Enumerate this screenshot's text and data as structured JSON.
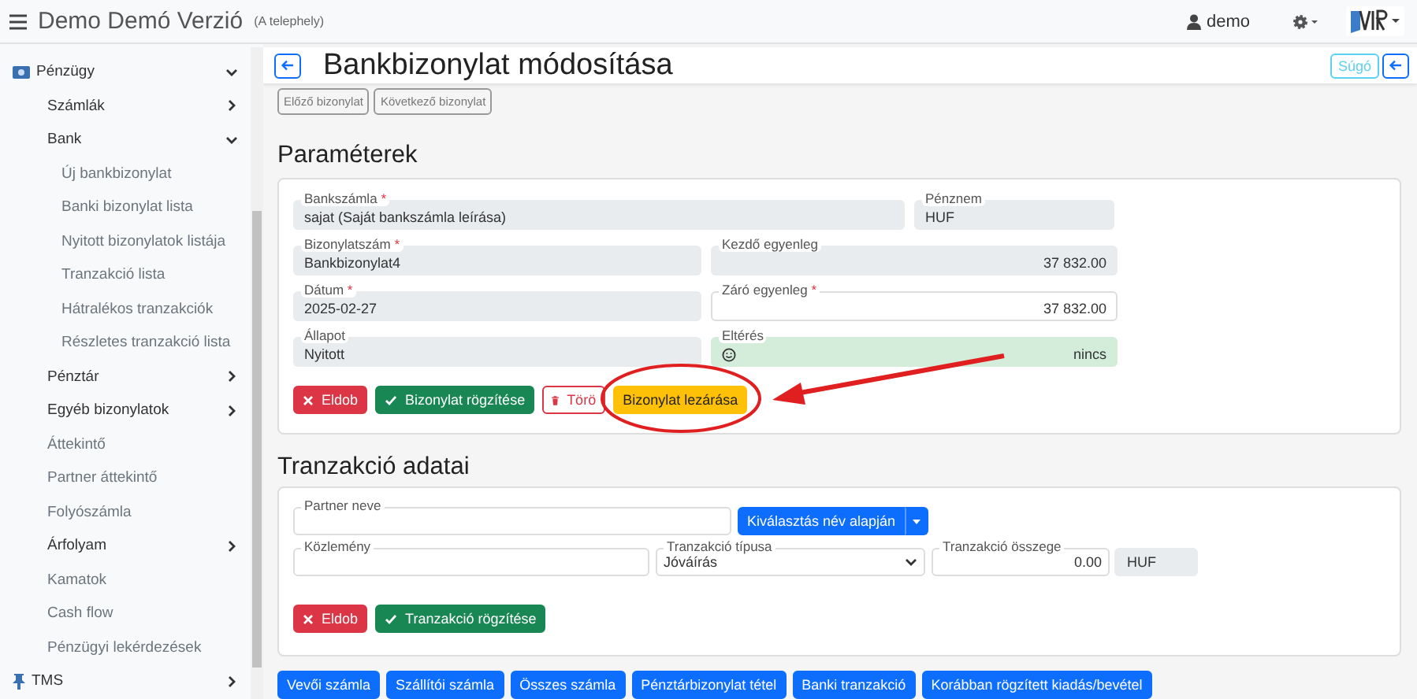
{
  "topbar": {
    "title": "Demo Demó Verzió",
    "subtitle": "(A telephely)",
    "user": "demo"
  },
  "sidebar": {
    "items": [
      {
        "label": "Pénzügy",
        "expanded": true,
        "children": [
          {
            "label": "Számlák",
            "expanded": false
          },
          {
            "label": "Bank",
            "expanded": true,
            "children": [
              {
                "label": "Új bankbizonylat"
              },
              {
                "label": "Banki bizonylat lista"
              },
              {
                "label": "Nyitott bizonylatok listája"
              },
              {
                "label": "Tranzakció lista"
              },
              {
                "label": "Hátralékos tranzakciók"
              },
              {
                "label": "Részletes tranzakció lista"
              }
            ]
          },
          {
            "label": "Pénztár",
            "expanded": false
          },
          {
            "label": "Egyéb bizonylatok",
            "expanded": false
          },
          {
            "label": "Áttekintő"
          },
          {
            "label": "Partner áttekintő"
          },
          {
            "label": "Folyószámla"
          },
          {
            "label": "Árfolyam",
            "expanded": false
          },
          {
            "label": "Kamatok"
          },
          {
            "label": "Cash flow"
          },
          {
            "label": "Pénzügyi lekérdezések"
          }
        ]
      },
      {
        "label": "TMS",
        "expanded": false
      }
    ]
  },
  "header": {
    "title": "Bankbizonylat módosítása",
    "help": "Súgó"
  },
  "nav_buttons": [
    "Előző bizonylat",
    "Következő bizonylat"
  ],
  "parameters": {
    "title": "Paraméterek",
    "rows": [
      [
        {
          "label": "Bankszámla",
          "required_mark": "*",
          "value": "sajat (Saját bankszámla leírása)",
          "kind": "readonly"
        },
        {
          "label": "Pénznem",
          "value": "HUF",
          "kind": "readonly"
        }
      ],
      [
        {
          "label": "Bizonylatszám",
          "required_mark": "*",
          "value": "Bankbizonylat4",
          "kind": "readonly"
        },
        {
          "label": "Kezdő egyenleg",
          "value": "37 832.00",
          "kind": "readonly"
        }
      ],
      [
        {
          "label": "Dátum",
          "required_mark": "*",
          "value": "2025-02-27",
          "kind": "readonly"
        },
        {
          "label": "Záró egyenleg",
          "required_mark": "*",
          "value": "37 832.00",
          "kind": "input"
        }
      ],
      [
        {
          "label": "Állapot",
          "value": "Nyitott",
          "kind": "readonly"
        },
        {
          "label": "Eltérés",
          "value": "nincs",
          "kind": "success"
        }
      ]
    ],
    "buttons": [
      {
        "label": "Eldob",
        "kind": "danger"
      },
      {
        "label": "Bizonylat rögzítése",
        "kind": "success"
      },
      {
        "label": "Törö",
        "kind": "outline-danger"
      },
      {
        "label": "Bizonylat lezárása",
        "kind": "warning"
      }
    ]
  },
  "transaction": {
    "title": "Tranzakció adatai",
    "partner": {
      "label": "Partner neve",
      "button": "Kiválasztás név alapján"
    },
    "comment": {
      "label": "Közlemény"
    },
    "type": {
      "label": "Tranzakció típusa",
      "value": "Jóváírás"
    },
    "amount": {
      "label": "Tranzakció összege",
      "value": "0.00",
      "currency": "HUF"
    },
    "buttons": [
      {
        "label": "Eldob",
        "kind": "danger"
      },
      {
        "label": "Tranzakció rögzítése",
        "kind": "success"
      }
    ]
  },
  "bottom_buttons": [
    "Vevői számla",
    "Szállítói számla",
    "Összes számla",
    "Pénztárbizonylat tétel",
    "Banki tranzakció",
    "Korábban rögzített kiadás/bevétel"
  ]
}
